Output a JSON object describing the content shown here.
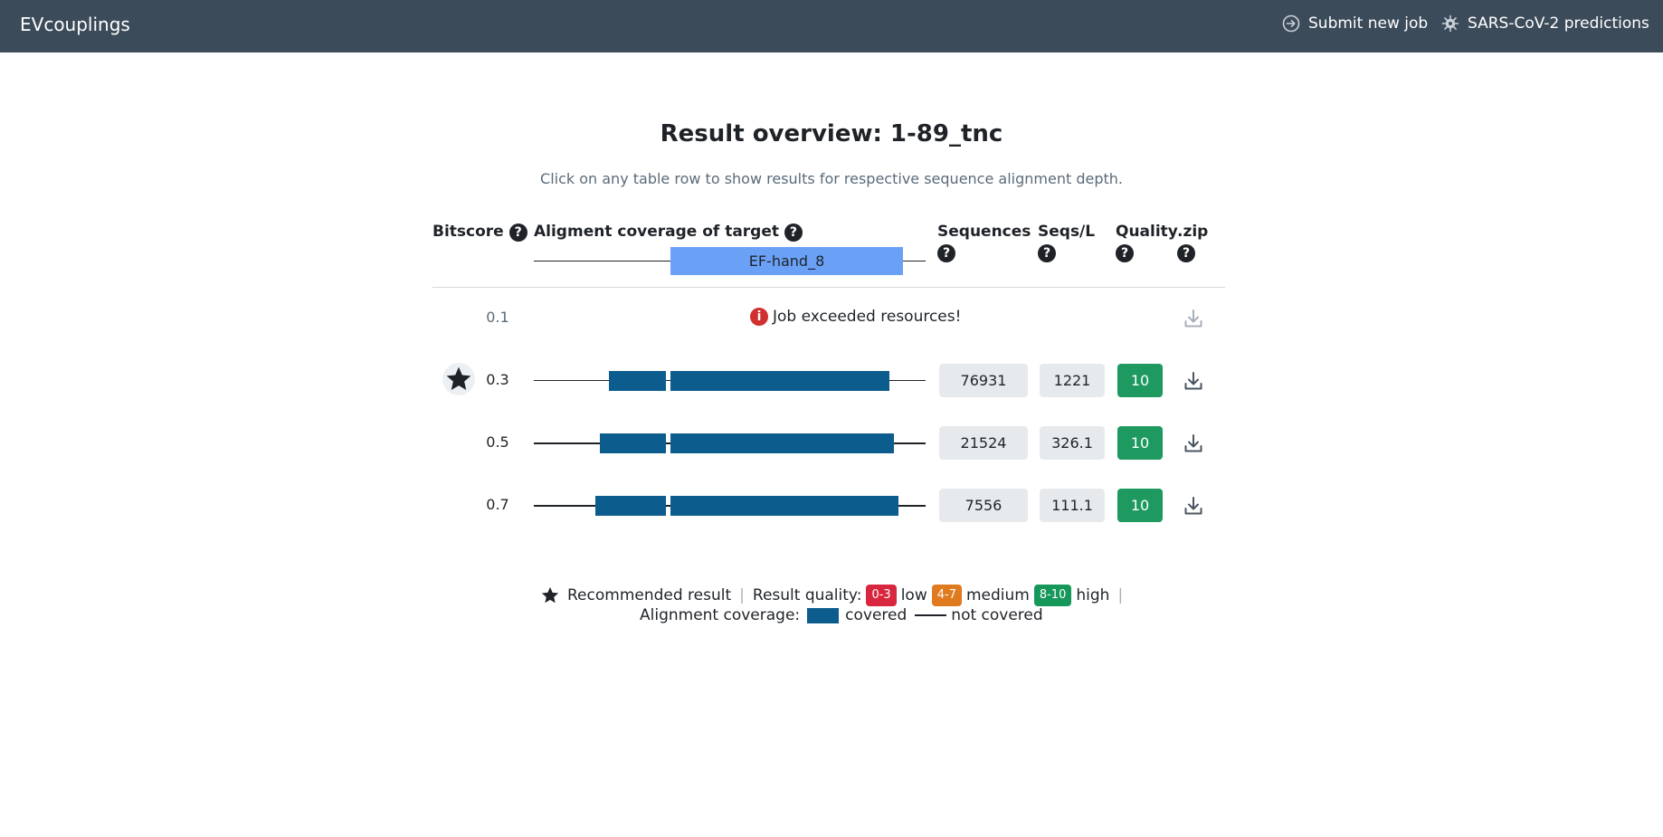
{
  "navbar": {
    "brand": "EVcouplings",
    "submit_label": "Submit new job",
    "sars_label": "SARS-CoV-2 predictions"
  },
  "page": {
    "title": "Result overview: 1-89_tnc",
    "subtitle": "Click on any table row to show results for respective sequence alignment depth."
  },
  "table": {
    "headers": {
      "bitscore": "Bitscore",
      "coverage": "Aligment coverage of target",
      "sequences": "Sequences",
      "seqs_per_l": "Seqs/L",
      "quality": "Quality",
      "zip": ".zip"
    },
    "help_glyph": "?",
    "domain_label": "EF-hand_8",
    "error_glyph": "i",
    "rows": [
      {
        "bitscore": "0.1",
        "error": "Job exceeded resources!"
      },
      {
        "bitscore": "0.3",
        "recommended": true,
        "sequences": "76931",
        "seqs_per_l": "1221",
        "quality": "10"
      },
      {
        "bitscore": "0.5",
        "sequences": "21524",
        "seqs_per_l": "326.1",
        "quality": "10"
      },
      {
        "bitscore": "0.7",
        "sequences": "7556",
        "seqs_per_l": "111.1",
        "quality": "10"
      }
    ]
  },
  "legend": {
    "recommended": "Recommended result",
    "separator": "|",
    "quality_label": "Result quality:",
    "low_range": "0-3",
    "low": "low",
    "medium_range": "4-7",
    "medium": "medium",
    "high_range": "8-10",
    "high": "high",
    "coverage_label": "Alignment coverage:",
    "covered": "covered",
    "not_covered": "not covered"
  },
  "colors": {
    "navbar": "#3c4b5a",
    "domain": "#6aa1f7",
    "covered": "#0d5c8e",
    "quality_high": "#1e9a61",
    "quality_medium": "#e07a1f",
    "quality_low": "#d7263d",
    "error": "#d0302f"
  },
  "icons": {
    "submit": "arrow-circle-icon",
    "sars": "virus-icon",
    "help": "question-circle-icon",
    "download": "download-icon",
    "recommended": "star-icon",
    "error": "info-circle-icon"
  }
}
